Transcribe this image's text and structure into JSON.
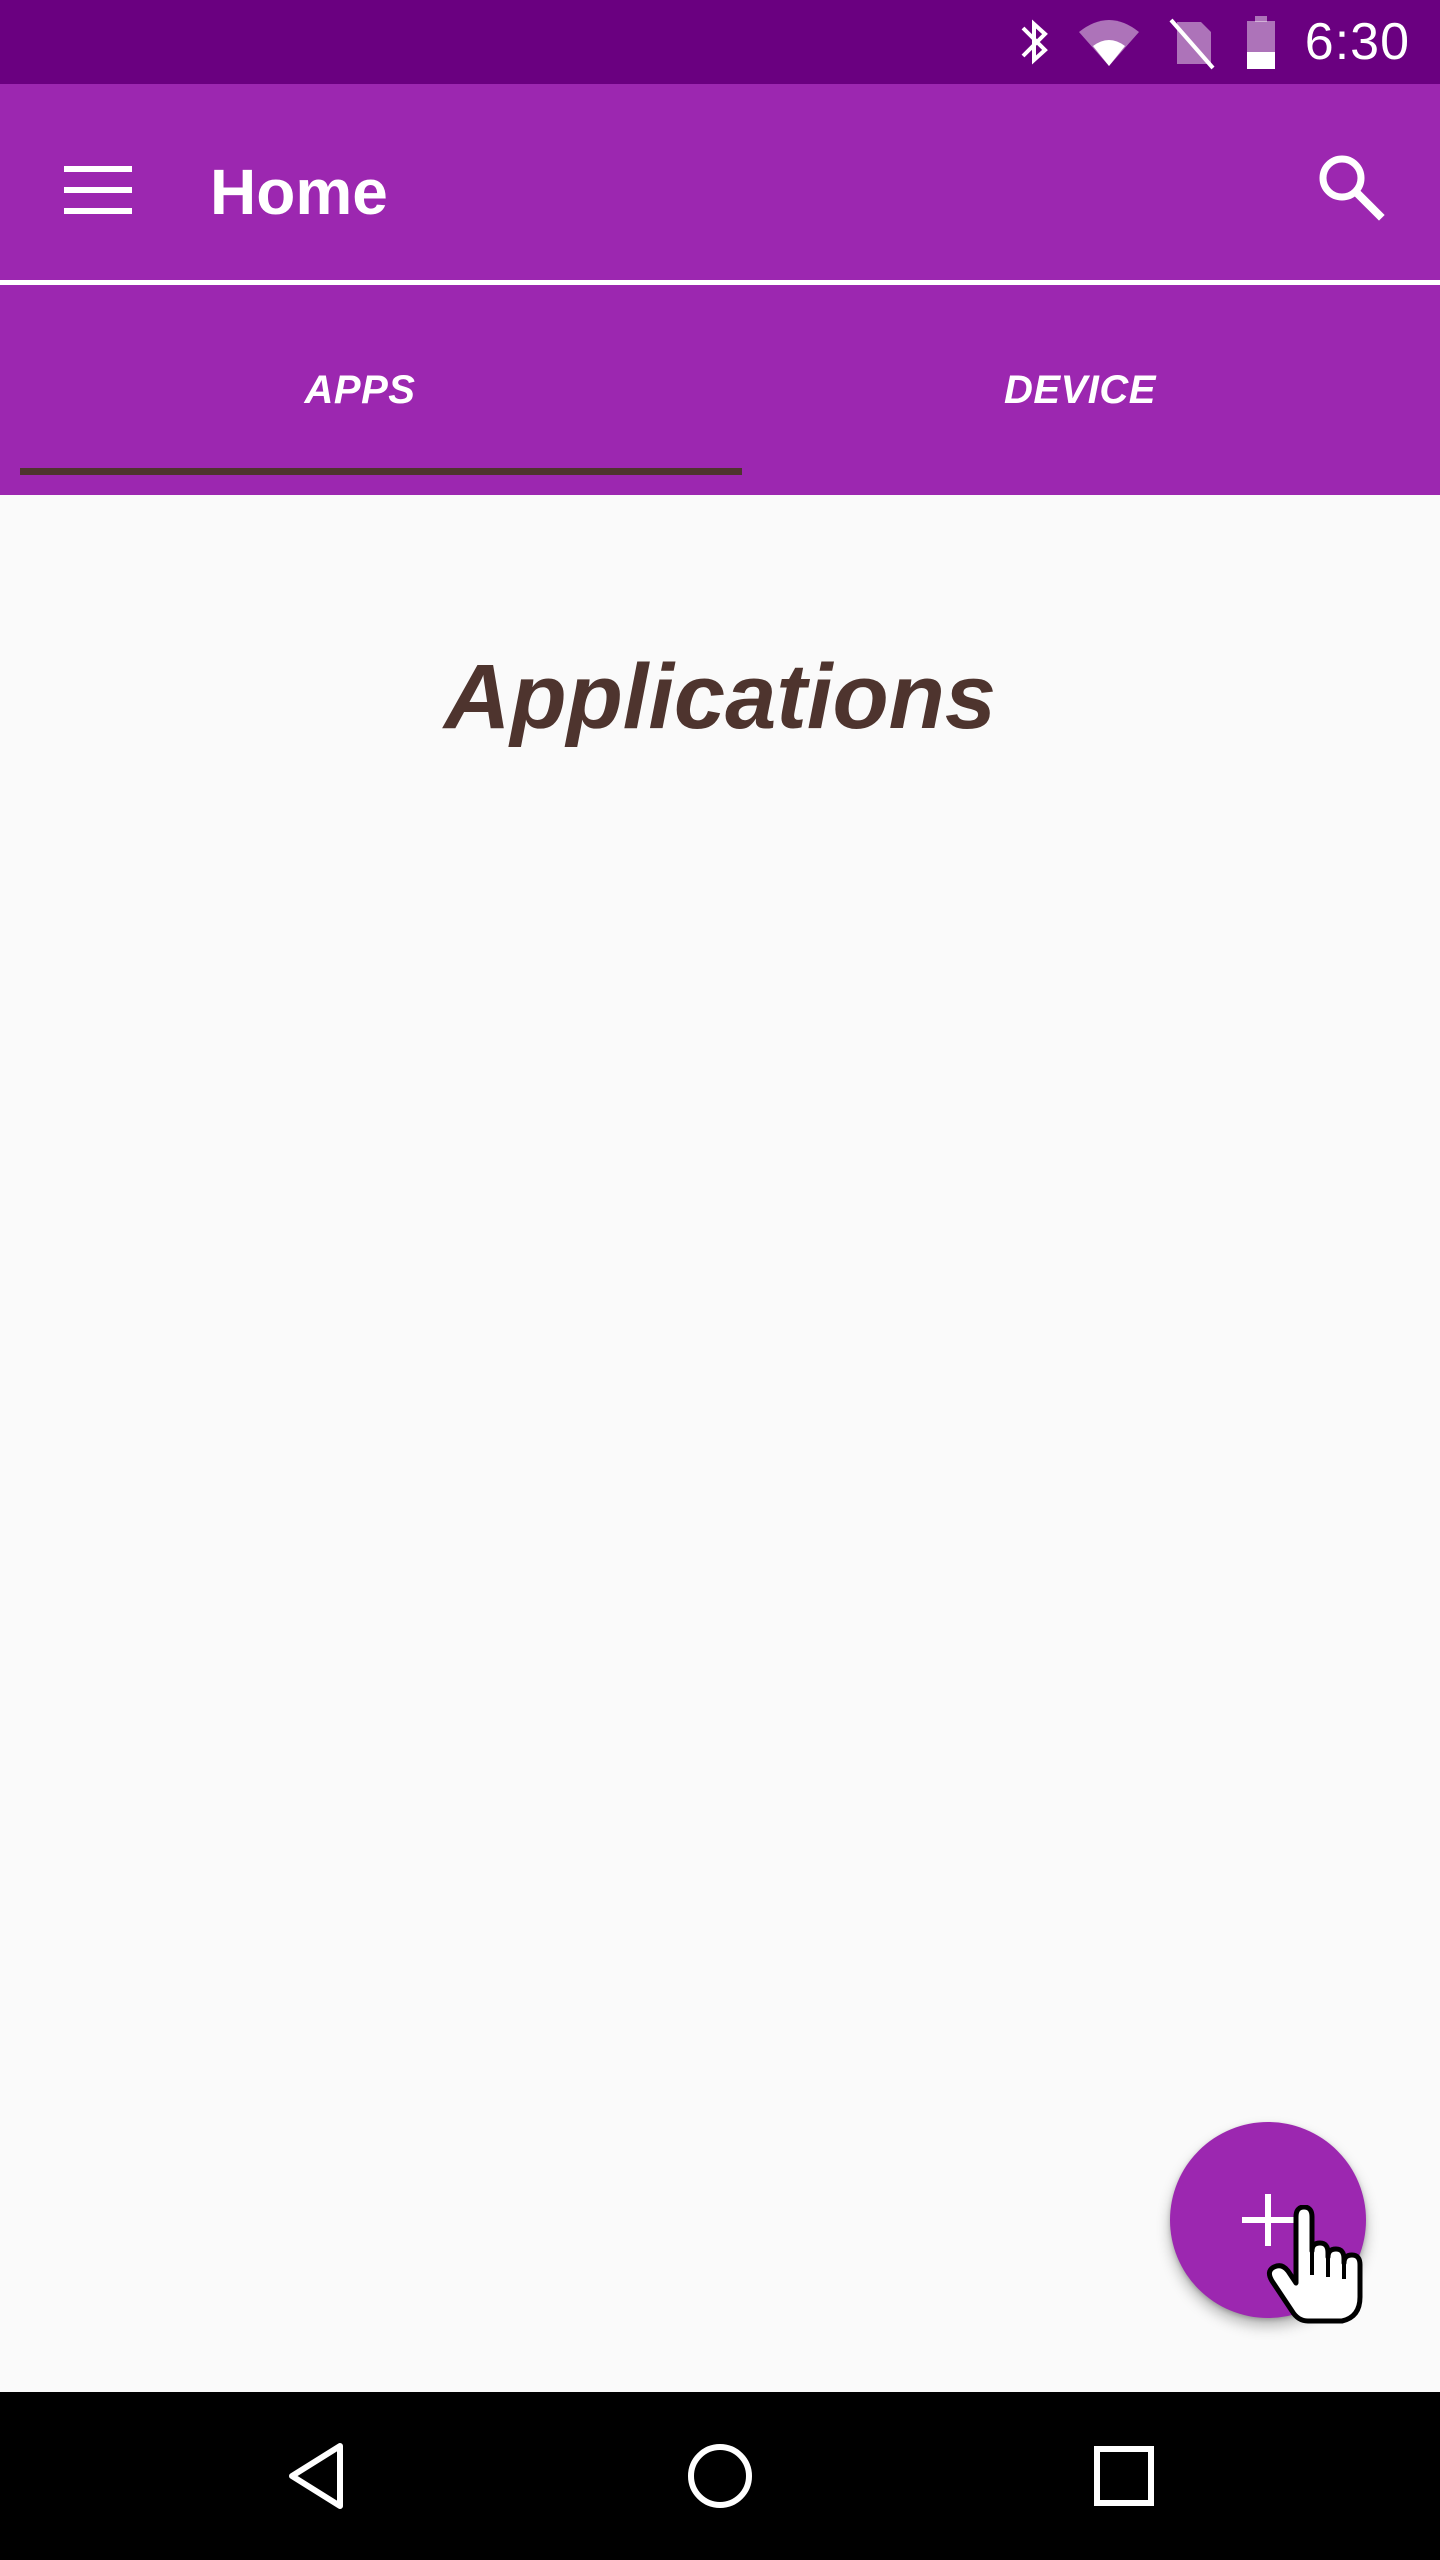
{
  "status_bar": {
    "time": "6:30",
    "icons": [
      "bluetooth-icon",
      "wifi-icon",
      "no-sim-icon",
      "battery-icon"
    ]
  },
  "app_bar": {
    "title": "Home",
    "menu_icon": "menu-icon",
    "search_icon": "search-icon"
  },
  "tabs": [
    {
      "label": "APPS",
      "selected": true
    },
    {
      "label": "DEVICE",
      "selected": false
    }
  ],
  "content": {
    "heading": "Applications"
  },
  "fab": {
    "icon": "plus-icon"
  },
  "nav_bar": {
    "icons": [
      "back-icon",
      "home-icon",
      "recents-icon"
    ]
  },
  "colors": {
    "primary": "#9c27b0",
    "primary_dark": "#6a0080",
    "accent_text": "#4e342e",
    "background": "#fafafa"
  }
}
